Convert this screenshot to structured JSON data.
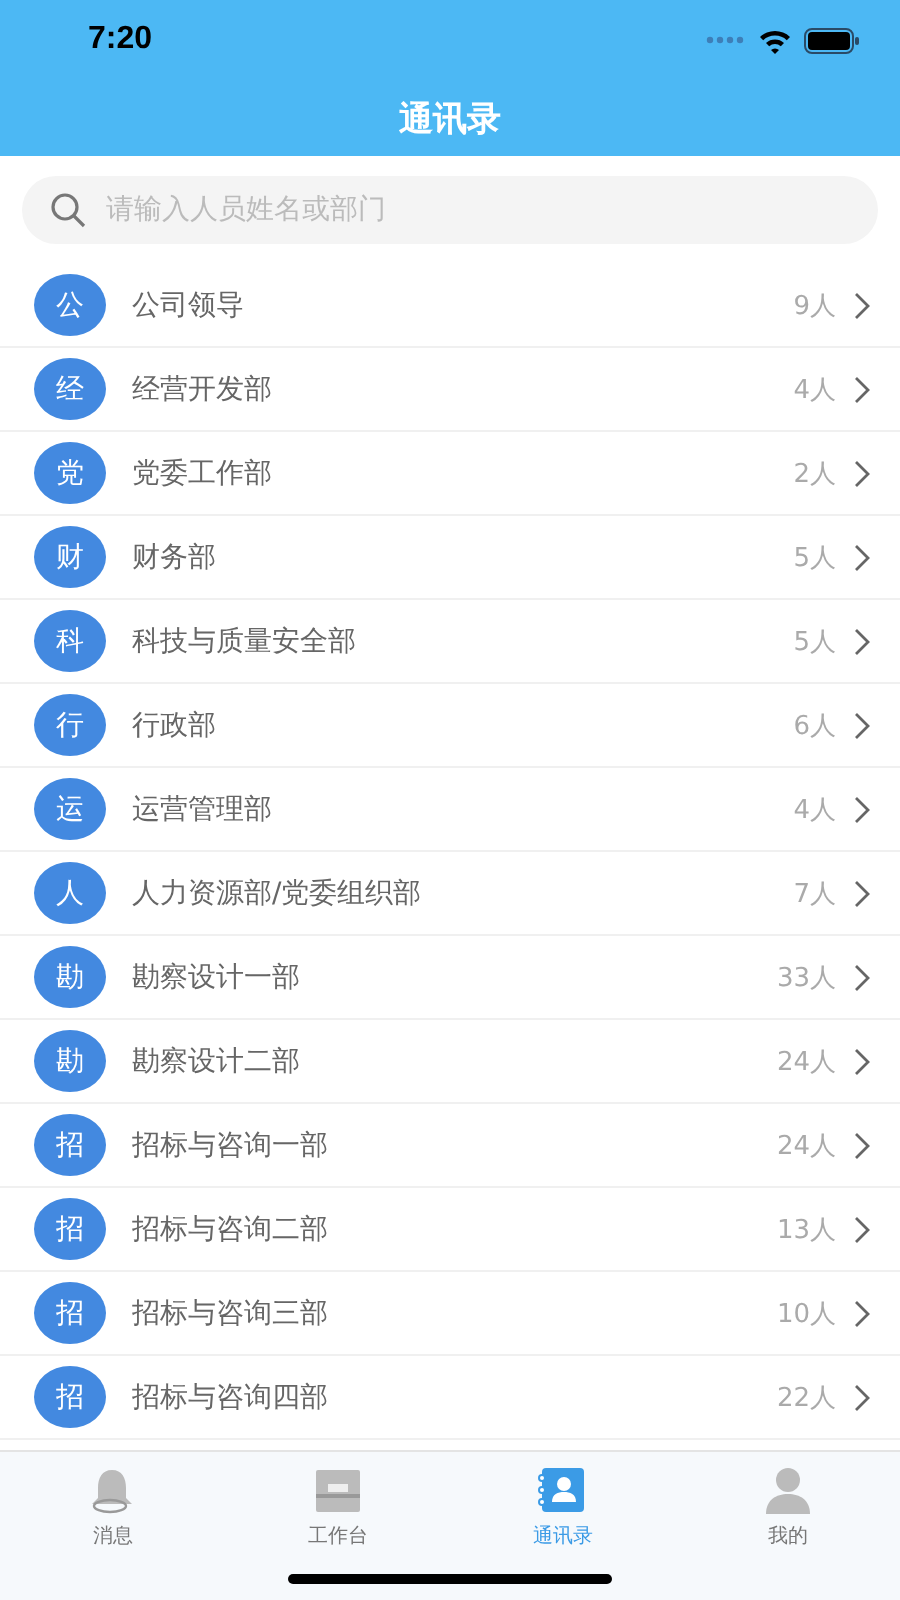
{
  "status_bar": {
    "time": "7:20"
  },
  "nav": {
    "title": "通讯录"
  },
  "search": {
    "placeholder": "请输入人员姓名或部门"
  },
  "departments": [
    {
      "badge": "公",
      "name": "公司领导",
      "count": "9人"
    },
    {
      "badge": "经",
      "name": "经营开发部",
      "count": "4人"
    },
    {
      "badge": "党",
      "name": "党委工作部",
      "count": "2人"
    },
    {
      "badge": "财",
      "name": "财务部",
      "count": "5人"
    },
    {
      "badge": "科",
      "name": "科技与质量安全部",
      "count": "5人"
    },
    {
      "badge": "行",
      "name": "行政部",
      "count": "6人"
    },
    {
      "badge": "运",
      "name": "运营管理部",
      "count": "4人"
    },
    {
      "badge": "人",
      "name": "人力资源部/党委组织部",
      "count": "7人"
    },
    {
      "badge": "勘",
      "name": "勘察设计一部",
      "count": "33人"
    },
    {
      "badge": "勘",
      "name": "勘察设计二部",
      "count": "24人"
    },
    {
      "badge": "招",
      "name": "招标与咨询一部",
      "count": "24人"
    },
    {
      "badge": "招",
      "name": "招标与咨询二部",
      "count": "13人"
    },
    {
      "badge": "招",
      "name": "招标与咨询三部",
      "count": "10人"
    },
    {
      "badge": "招",
      "name": "招标与咨询四部",
      "count": "22人"
    }
  ],
  "tabs": [
    {
      "label": "消息",
      "kind": "bell",
      "selected": false
    },
    {
      "label": "工作台",
      "kind": "desk",
      "selected": false
    },
    {
      "label": "通讯录",
      "kind": "contacts",
      "selected": true
    },
    {
      "label": "我的",
      "kind": "person",
      "selected": false
    }
  ]
}
